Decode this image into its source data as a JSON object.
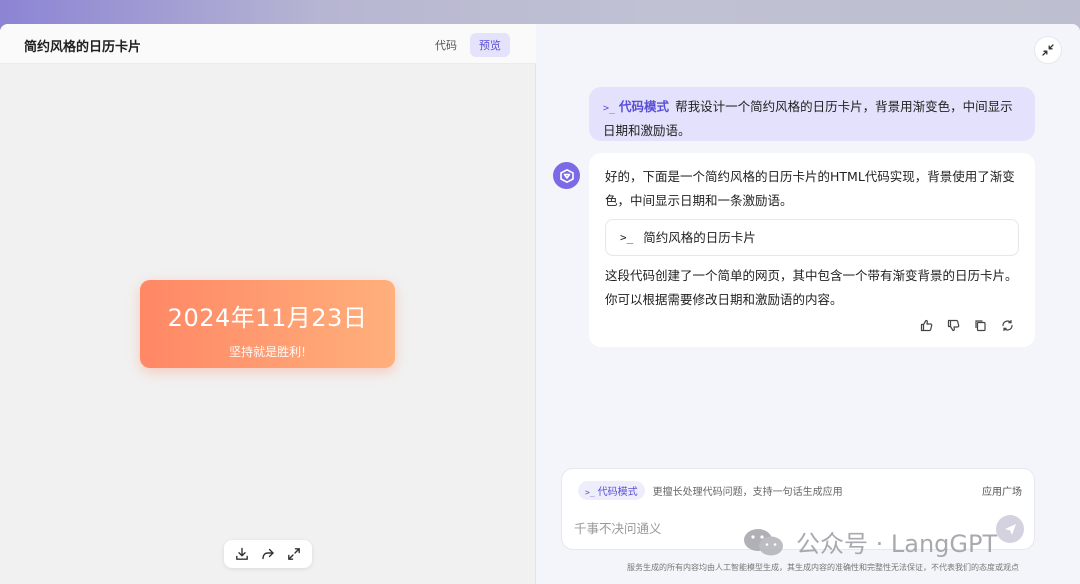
{
  "left": {
    "title": "简约风格的日历卡片",
    "tabs": [
      {
        "label": "代码",
        "active": false
      },
      {
        "label": "预览",
        "active": true
      }
    ],
    "card": {
      "date": "2024年11月23日",
      "motto": "坚持就是胜利!",
      "gradient": [
        "#ff8765",
        "#ffb07c"
      ]
    },
    "toolbar": {
      "icons": [
        "download-icon",
        "share-icon",
        "fullscreen-icon"
      ]
    }
  },
  "right": {
    "user_message": {
      "mode": "代码模式",
      "text": "帮我设计一个简约风格的日历卡片，背景用渐变色，中间显示日期和激励语。"
    },
    "bot_message": {
      "intro": "好的，下面是一个简约风格的日历卡片的HTML代码实现，背景使用了渐变色，中间显示日期和一条激励语。",
      "code_block_label": "简约风格的日历卡片",
      "outro": "这段代码创建了一个简单的网页，其中包含一个带有渐变背景的日历卡片。你可以根据需要修改日期和激励语的内容。",
      "actions": [
        "thumbs-up-icon",
        "thumbs-down-icon",
        "copy-icon",
        "regenerate-icon"
      ]
    },
    "input": {
      "mode_pill": "代码模式",
      "hint": "更擅长处理代码问题，支持一句话生成应用",
      "app_square": "应用广场",
      "placeholder": "千事不决问通义"
    },
    "disclaimer": "服务生成的所有内容均由人工智能模型生成，其生成内容的准确性和完整性无法保证，不代表我们的态度或观点"
  },
  "watermark": {
    "text": "公众号 · LangGPT"
  },
  "colors": {
    "accent": "#5b4fd6",
    "user_bubble": "#e3e1fb",
    "avatar": "#7b69e6"
  }
}
